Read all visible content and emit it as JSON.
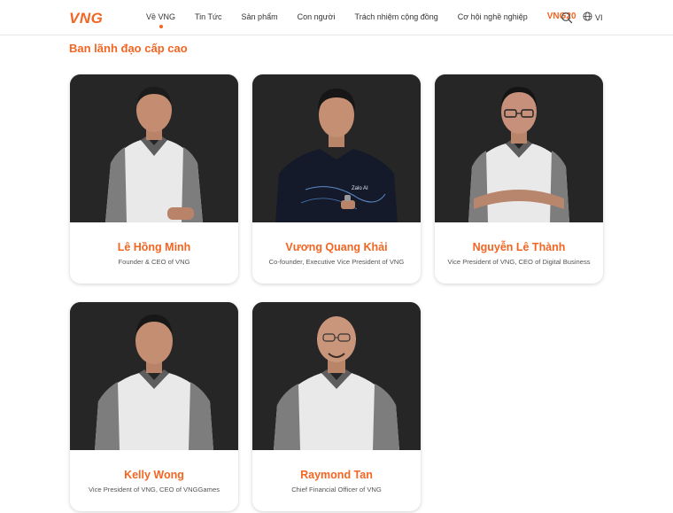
{
  "header": {
    "logo": "VNG",
    "nav": [
      {
        "label": "Về VNG",
        "active": true
      },
      {
        "label": "Tin Tức",
        "active": false
      },
      {
        "label": "Sản phẩm",
        "active": false
      },
      {
        "label": "Con người",
        "active": false
      },
      {
        "label": "Trách nhiệm cộng đồng",
        "active": false
      },
      {
        "label": "Cơ hội nghề nghiệp",
        "active": false
      }
    ],
    "brand_link": "VNG20",
    "language": "VI"
  },
  "section": {
    "title": "Ban lãnh đạo cấp cao"
  },
  "leaders": [
    {
      "name": "Lê Hồng Minh",
      "role": "Founder & CEO of VNG"
    },
    {
      "name": "Vương Quang Khải",
      "role": "Co-founder, Executive Vice President of VNG"
    },
    {
      "name": "Nguyễn Lê Thành",
      "role": "Vice President of VNG, CEO of Digital Business"
    },
    {
      "name": "Kelly Wong",
      "role": "Vice President of VNG, CEO of VNGGames"
    },
    {
      "name": "Raymond Tan",
      "role": "Chief Financial Officer of VNG"
    }
  ],
  "colors": {
    "accent": "#f26522",
    "photo_bg": "#262626"
  }
}
